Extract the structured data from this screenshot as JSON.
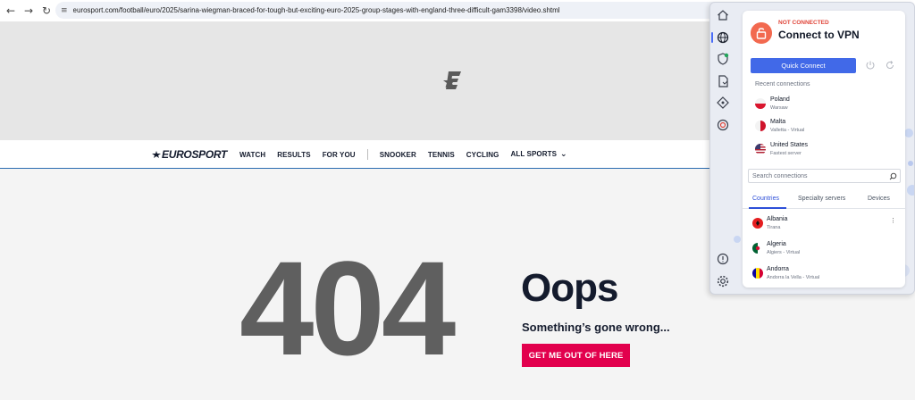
{
  "browser": {
    "url": "eurosport.com/football/euro/2025/sarina-wiegman-braced-for-tough-but-exciting-euro-2025-group-stages-with-england-three-difficult-gam3398/video.shtml",
    "back_icon": "arrow-left-icon",
    "forward_icon": "arrow-right-icon",
    "reload_icon": "reload-icon"
  },
  "nav": {
    "brand": "EUROSPORT",
    "links": [
      "WATCH",
      "RESULTS",
      "FOR YOU",
      "SNOOKER",
      "TENNIS",
      "CYCLING",
      "ALL SPORTS"
    ]
  },
  "error": {
    "code": "404",
    "title": "Oops",
    "subtitle": "Something’s gone wrong...",
    "button": "GET ME OUT OF HERE"
  },
  "vpn": {
    "status": "NOT CONNECTED",
    "headline": "Connect to VPN",
    "quick_connect": "Quick Connect",
    "recent_title": "Recent connections",
    "recent": [
      {
        "name": "Poland",
        "sub": "Warsaw"
      },
      {
        "name": "Malta",
        "sub": "Valletta - Virtual"
      },
      {
        "name": "United States",
        "sub": "Fastest server"
      }
    ],
    "search_placeholder": "Search connections",
    "tabs": [
      "Countries",
      "Specialty servers",
      "Devices"
    ],
    "countries": [
      {
        "name": "Albania",
        "sub": "Tirana"
      },
      {
        "name": "Algeria",
        "sub": "Algiers - Virtual"
      },
      {
        "name": "Andorra",
        "sub": "Andorra la Vella - Virtual"
      }
    ]
  },
  "colors": {
    "accent_pink": "#e2004d",
    "vpn_blue": "#4169e8",
    "status_red": "#e0463a"
  }
}
